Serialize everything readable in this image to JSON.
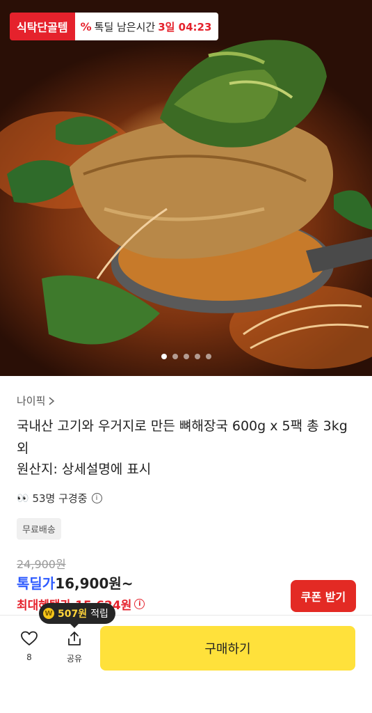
{
  "hero": {
    "badge_label": "식탁단골템",
    "deal_badge_label": "톡딜 남은시간",
    "deal_badge_time": "3일 04:23",
    "carousel_dots": 5,
    "carousel_active_index": 0
  },
  "product": {
    "seller": "나이픽",
    "title": "국내산 고기와 우거지로 만든 뼈해장국 600g x 5팩 총 3kg 외",
    "origin": "원산지: 상세설명에 표시",
    "viewers_text": "53명 구경중",
    "tag": "무료배송"
  },
  "price": {
    "original": "24,900원",
    "deal_label": "톡딜가",
    "deal_price": "16,900원~",
    "max_benefit": "최대혜택가 15,624원",
    "coupon_button": "쿠폰 받기"
  },
  "bottom_bar": {
    "points_value": "507원",
    "points_suffix": "적립",
    "like_count": "8",
    "share_label": "공유",
    "buy_button": "구매하기"
  },
  "colors": {
    "accent_red": "#e5222c",
    "deal_blue": "#2e5bff",
    "buy_yellow": "#ffe13b"
  }
}
